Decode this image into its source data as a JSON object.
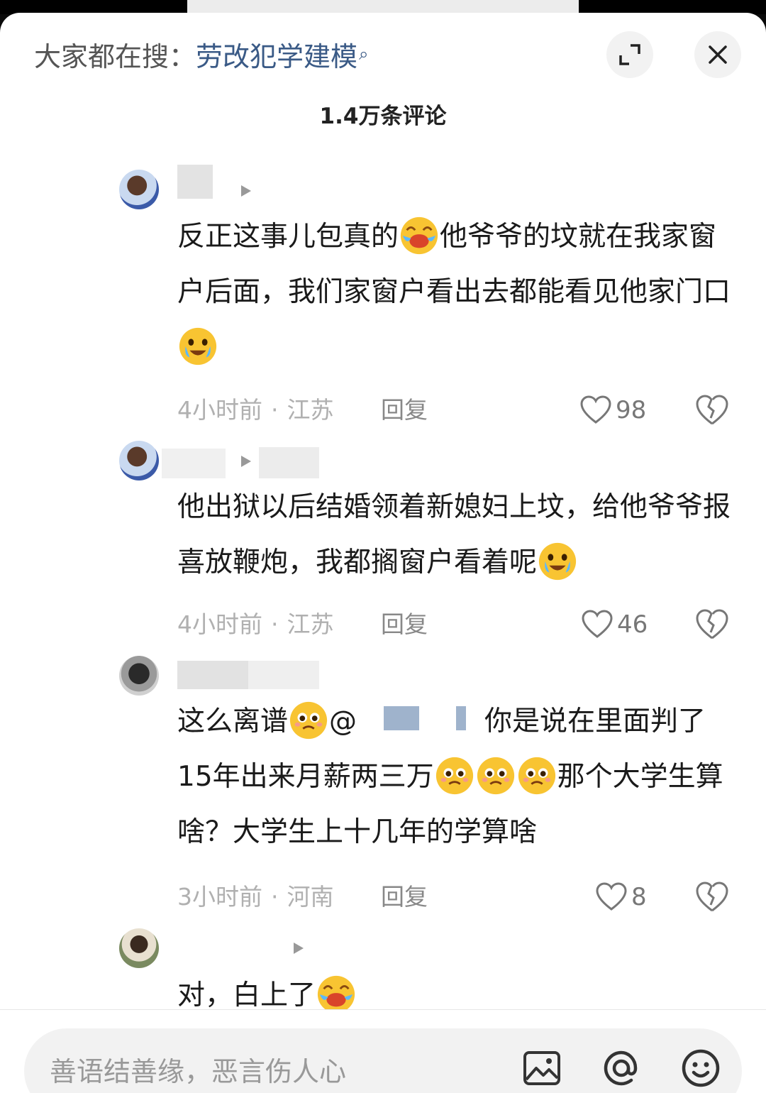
{
  "header": {
    "search_prefix": "大家都在搜：",
    "search_term": "劳改犯学建模",
    "comment_count": "1.4万条评论"
  },
  "comments": [
    {
      "text_segments": [
        "反正这事儿包真的",
        "他爷爷的坟就在我家窗户后面，我们家窗户看出去都能看见他家门口"
      ],
      "time": "4小时前",
      "location": "江苏",
      "reply": "回复",
      "likes": "98"
    },
    {
      "text_segments": [
        "他出狱以后结婚领着新媳妇上坟，给他爷爷报喜放鞭炮，我都搁窗户看着呢"
      ],
      "time": "4小时前",
      "location": "江苏",
      "reply": "回复",
      "likes": "46"
    },
    {
      "text_segments": [
        "这么离谱",
        "@",
        "你是说在里面判了15年出来月薪两三万",
        "那个大学生算啥？大学生上十几年的学算啥"
      ],
      "time": "3小时前",
      "location": "河南",
      "reply": "回复",
      "likes": "8"
    },
    {
      "text_segments": [
        "对，白上了"
      ]
    }
  ],
  "input": {
    "placeholder": "善语结善缘，恶言伤人心"
  },
  "icons": {
    "search": "search-icon",
    "expand": "expand-icon",
    "close": "close-icon",
    "like": "heart-icon",
    "dislike": "broken-heart-icon",
    "image": "image-icon",
    "mention": "at-icon",
    "emoji": "emoji-icon"
  },
  "colors": {
    "search_link": "#3a5a86",
    "meta_gray": "#b0b0b0"
  }
}
